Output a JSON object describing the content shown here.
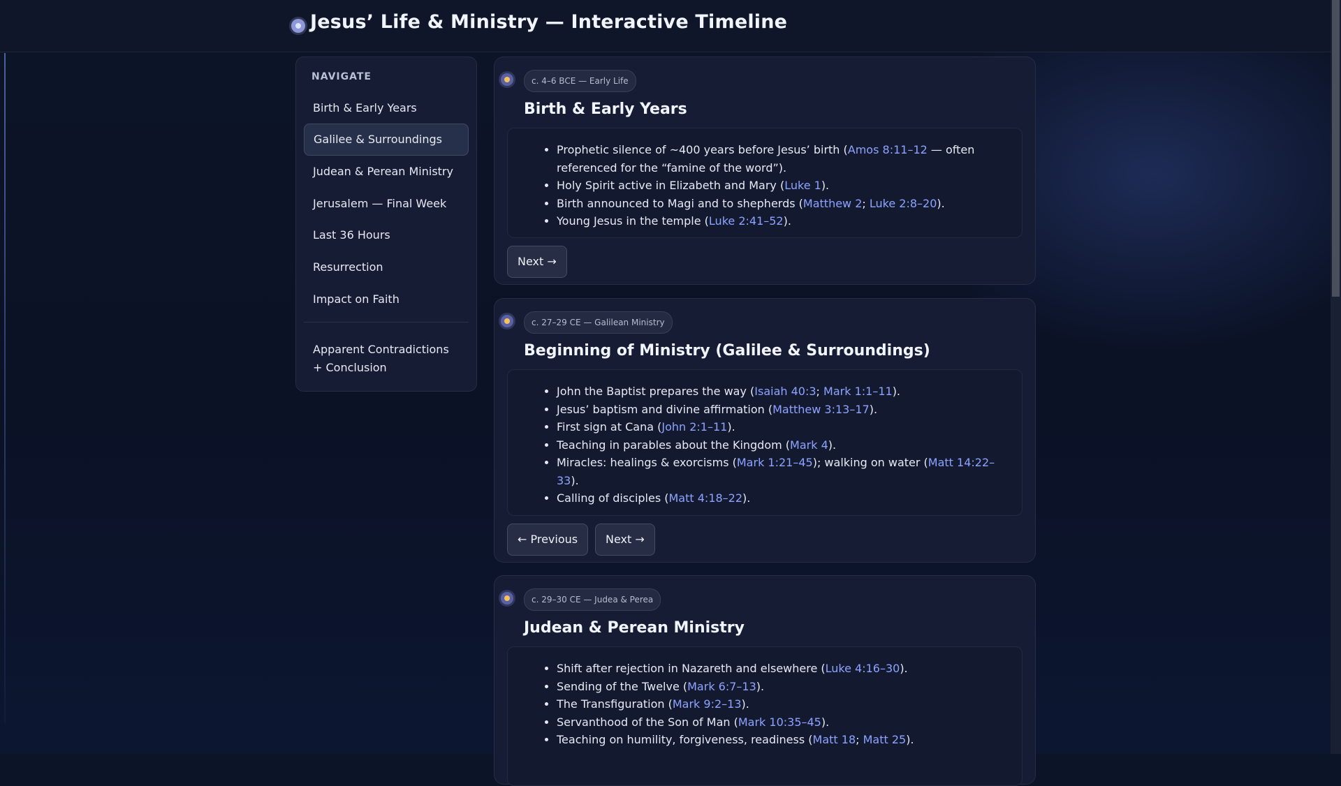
{
  "app": {
    "title": "Jesus’ Life & Ministry — Interactive Timeline"
  },
  "sidebar": {
    "heading": "NAVIGATE",
    "items": [
      {
        "label": "Birth & Early Years"
      },
      {
        "label": "Galilee & Surroundings",
        "active": true
      },
      {
        "label": "Judean & Perean Ministry"
      },
      {
        "label": "Jerusalem — Final Week"
      },
      {
        "label": "Last 36 Hours"
      },
      {
        "label": "Resurrection"
      },
      {
        "label": "Impact on Faith"
      },
      {
        "label": "Apparent Contradictions + Conclusion"
      }
    ]
  },
  "sections": [
    {
      "badge": "c. 4–6 BCE — Early Life",
      "title": "Birth & Early Years",
      "bullets": [
        [
          {
            "t": "Prophetic silence of ~400 years before Jesus’ birth ("
          },
          {
            "t": "Amos 8:11–12",
            "link": true
          },
          {
            "t": " — often referenced for the “famine of the word”)."
          }
        ],
        [
          {
            "t": "Holy Spirit active in Elizabeth and Mary ("
          },
          {
            "t": "Luke 1",
            "link": true
          },
          {
            "t": ")."
          }
        ],
        [
          {
            "t": "Birth announced to Magi and to shepherds ("
          },
          {
            "t": "Matthew 2",
            "link": true
          },
          {
            "t": "; "
          },
          {
            "t": "Luke 2:8–20",
            "link": true
          },
          {
            "t": ")."
          }
        ],
        [
          {
            "t": "Young Jesus in the temple ("
          },
          {
            "t": "Luke 2:41–52",
            "link": true
          },
          {
            "t": ")."
          }
        ]
      ],
      "buttons": {
        "next": "Next →"
      }
    },
    {
      "badge": "c. 27–29 CE — Galilean Ministry",
      "title": "Beginning of Ministry (Galilee & Surroundings)",
      "bullets": [
        [
          {
            "t": "John the Baptist prepares the way ("
          },
          {
            "t": "Isaiah 40:3",
            "link": true
          },
          {
            "t": "; "
          },
          {
            "t": "Mark 1:1–11",
            "link": true
          },
          {
            "t": ")."
          }
        ],
        [
          {
            "t": "Jesus’ baptism and divine affirmation ("
          },
          {
            "t": "Matthew 3:13–17",
            "link": true
          },
          {
            "t": ")."
          }
        ],
        [
          {
            "t": "First sign at Cana ("
          },
          {
            "t": "John 2:1–11",
            "link": true
          },
          {
            "t": ")."
          }
        ],
        [
          {
            "t": "Teaching in parables about the Kingdom ("
          },
          {
            "t": "Mark 4",
            "link": true
          },
          {
            "t": ")."
          }
        ],
        [
          {
            "t": "Miracles: healings & exorcisms ("
          },
          {
            "t": "Mark 1:21–45",
            "link": true
          },
          {
            "t": "); walking on water ("
          },
          {
            "t": "Matt 14:22–33",
            "link": true
          },
          {
            "t": ")."
          }
        ],
        [
          {
            "t": "Calling of disciples ("
          },
          {
            "t": "Matt 4:18–22",
            "link": true
          },
          {
            "t": ")."
          }
        ]
      ],
      "buttons": {
        "previous": "← Previous",
        "next": "Next →"
      }
    },
    {
      "badge": "c. 29–30 CE — Judea & Perea",
      "title": "Judean & Perean Ministry",
      "bullets": [
        [
          {
            "t": "Shift after rejection in Nazareth and elsewhere ("
          },
          {
            "t": "Luke 4:16–30",
            "link": true
          },
          {
            "t": ")."
          }
        ],
        [
          {
            "t": "Sending of the Twelve ("
          },
          {
            "t": "Mark 6:7–13",
            "link": true
          },
          {
            "t": ")."
          }
        ],
        [
          {
            "t": "The Transfiguration ("
          },
          {
            "t": "Mark 9:2–13",
            "link": true
          },
          {
            "t": ")."
          }
        ],
        [
          {
            "t": "Servanthood of the Son of Man ("
          },
          {
            "t": "Mark 10:35–45",
            "link": true
          },
          {
            "t": ")."
          }
        ],
        [
          {
            "t": "Teaching on humility, forgiveness, readiness ("
          },
          {
            "t": "Matt 18",
            "link": true
          },
          {
            "t": "; "
          },
          {
            "t": "Matt 25",
            "link": true
          },
          {
            "t": ")."
          }
        ]
      ]
    }
  ],
  "colors": {
    "background": "#0c1428",
    "panel": "#151c33",
    "link": "#8ea3ff",
    "accent_dot": "#f4c261"
  }
}
